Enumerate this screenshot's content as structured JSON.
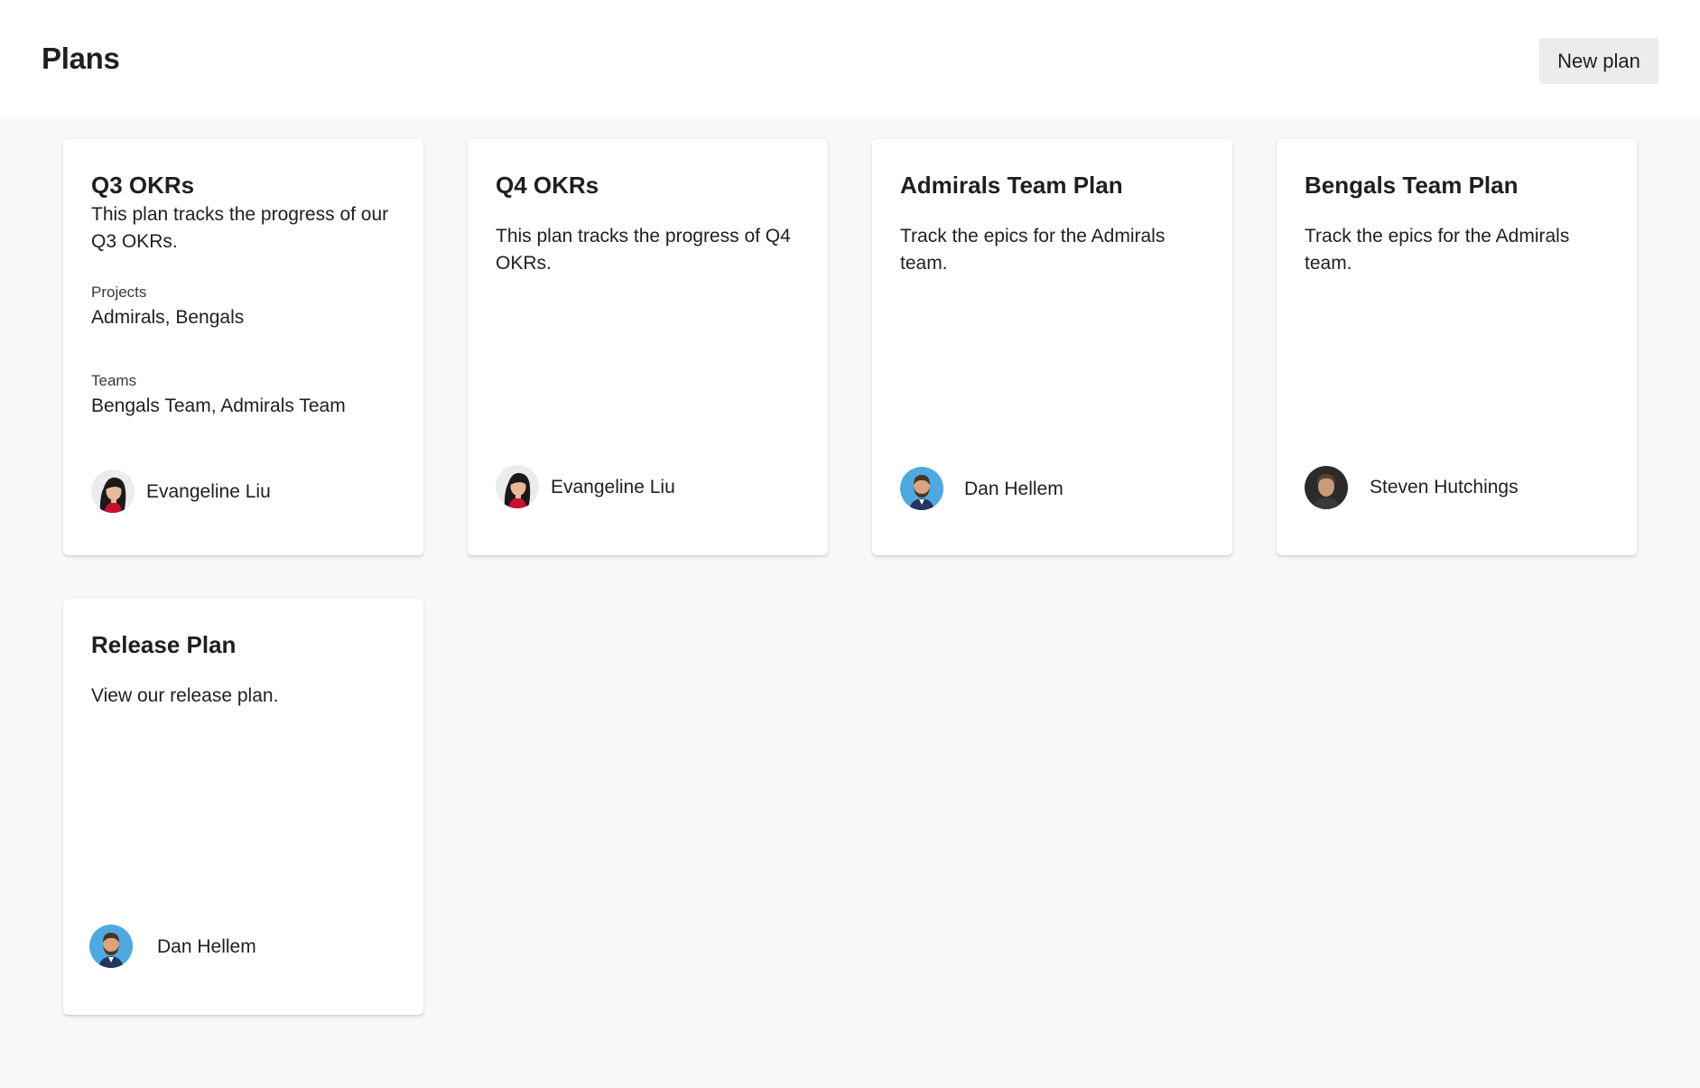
{
  "header": {
    "title": "Plans",
    "new_plan_label": "New plan"
  },
  "plans": [
    {
      "title": "Q3 OKRs",
      "description": "This plan tracks the progress of our Q3 OKRs.",
      "projects_label": "Projects",
      "projects": "Admirals, Bengals",
      "teams_label": "Teams",
      "teams": "Bengals Team, Admirals Team",
      "owner": "Evangeline Liu",
      "avatar_icon": "avatar-evangeline-icon"
    },
    {
      "title": "Q4 OKRs",
      "description": "This plan tracks the progress of Q4 OKRs.",
      "owner": "Evangeline Liu",
      "avatar_icon": "avatar-evangeline-icon"
    },
    {
      "title": "Admirals Team Plan",
      "description": "Track the epics for the Admirals team.",
      "owner": "Dan Hellem",
      "avatar_icon": "avatar-dan-icon"
    },
    {
      "title": "Bengals Team Plan",
      "description": "Track the epics for the Admirals team.",
      "owner": "Steven Hutchings",
      "avatar_icon": "avatar-steven-icon"
    },
    {
      "title": "Release Plan",
      "description": "View our release plan.",
      "owner": "Dan Hellem",
      "avatar_icon": "avatar-dan-icon"
    }
  ],
  "colors": {
    "page_background": "#f8f8f8",
    "card_background": "#ffffff",
    "button_background": "#ececec",
    "text_primary": "#201f1e"
  }
}
